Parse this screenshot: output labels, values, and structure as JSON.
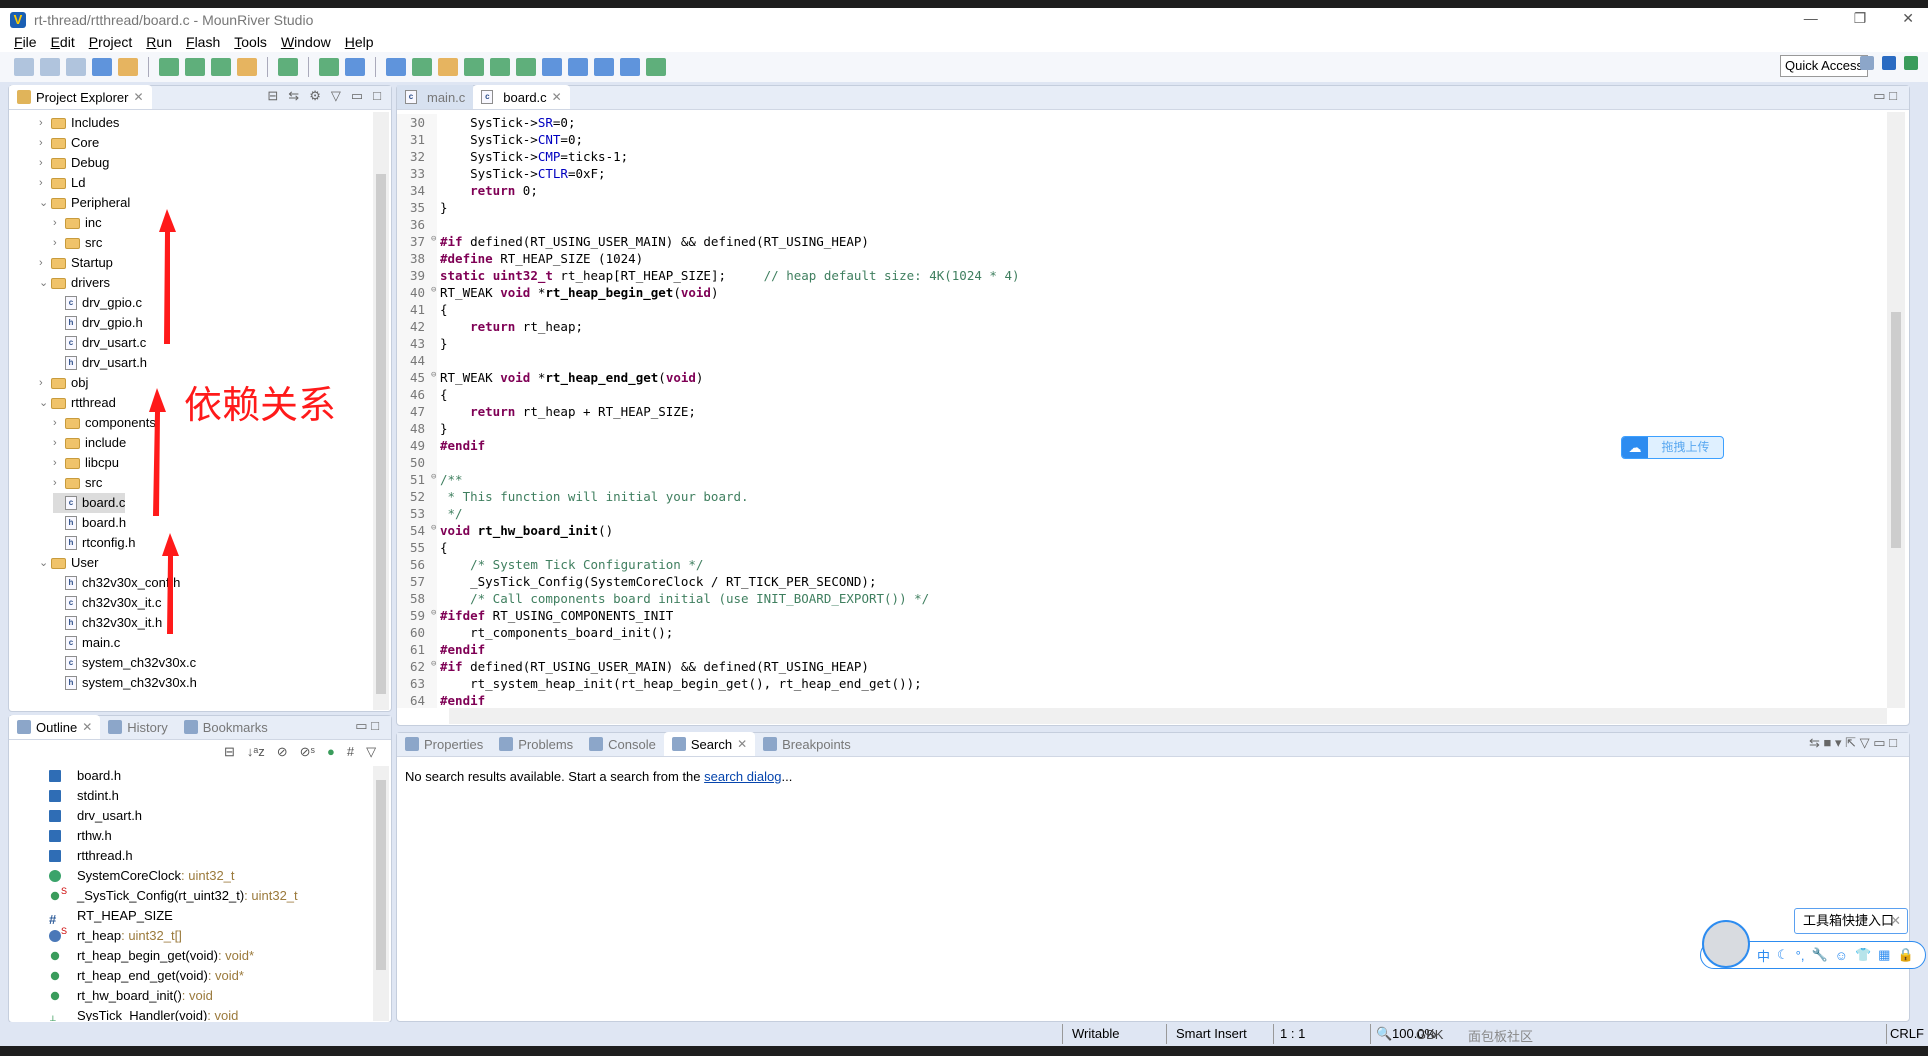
{
  "window": {
    "title": "rt-thread/rtthread/board.c - MounRiver Studio",
    "logo": "V"
  },
  "menu": [
    "File",
    "Edit",
    "Project",
    "Run",
    "Flash",
    "Tools",
    "Window",
    "Help"
  ],
  "toolbar": {
    "quick_access": "Quick Access"
  },
  "explorer": {
    "title": "Project Explorer",
    "items": [
      {
        "label": "Includes",
        "level": 0,
        "kind": "includes",
        "expanded": false
      },
      {
        "label": "Core",
        "level": 0,
        "kind": "folder",
        "expanded": false
      },
      {
        "label": "Debug",
        "level": 0,
        "kind": "folder",
        "expanded": false
      },
      {
        "label": "Ld",
        "level": 0,
        "kind": "folder",
        "expanded": false
      },
      {
        "label": "Peripheral",
        "level": 0,
        "kind": "folder",
        "expanded": true
      },
      {
        "label": "inc",
        "level": 1,
        "kind": "folder",
        "expanded": false
      },
      {
        "label": "src",
        "level": 1,
        "kind": "folder",
        "expanded": false
      },
      {
        "label": "Startup",
        "level": 0,
        "kind": "folder",
        "expanded": false
      },
      {
        "label": "drivers",
        "level": 0,
        "kind": "folder",
        "expanded": true
      },
      {
        "label": "drv_gpio.c",
        "level": 1,
        "kind": "c"
      },
      {
        "label": "drv_gpio.h",
        "level": 1,
        "kind": "h"
      },
      {
        "label": "drv_usart.c",
        "level": 1,
        "kind": "c"
      },
      {
        "label": "drv_usart.h",
        "level": 1,
        "kind": "h"
      },
      {
        "label": "obj",
        "level": 0,
        "kind": "folder",
        "expanded": false
      },
      {
        "label": "rtthread",
        "level": 0,
        "kind": "folder",
        "expanded": true
      },
      {
        "label": "components",
        "level": 1,
        "kind": "folder",
        "expanded": false
      },
      {
        "label": "include",
        "level": 1,
        "kind": "folder",
        "expanded": false
      },
      {
        "label": "libcpu",
        "level": 1,
        "kind": "folder",
        "expanded": false
      },
      {
        "label": "src",
        "level": 1,
        "kind": "folder",
        "expanded": false
      },
      {
        "label": "board.c",
        "level": 1,
        "kind": "c",
        "selected": true
      },
      {
        "label": "board.h",
        "level": 1,
        "kind": "h"
      },
      {
        "label": "rtconfig.h",
        "level": 1,
        "kind": "h"
      },
      {
        "label": "User",
        "level": 0,
        "kind": "folder",
        "expanded": true
      },
      {
        "label": "ch32v30x_conf.h",
        "level": 1,
        "kind": "h"
      },
      {
        "label": "ch32v30x_it.c",
        "level": 1,
        "kind": "c"
      },
      {
        "label": "ch32v30x_it.h",
        "level": 1,
        "kind": "h"
      },
      {
        "label": "main.c",
        "level": 1,
        "kind": "c"
      },
      {
        "label": "system_ch32v30x.c",
        "level": 1,
        "kind": "c"
      },
      {
        "label": "system_ch32v30x.h",
        "level": 1,
        "kind": "h"
      }
    ]
  },
  "annotation": {
    "text": "依赖关系",
    "color": "#ff1a1a"
  },
  "editor": {
    "tabs": [
      {
        "label": "main.c",
        "active": false
      },
      {
        "label": "board.c",
        "active": true
      }
    ],
    "lines": [
      {
        "n": "30",
        "t": [
          [
            "",
            "    SysTick->"
          ],
          [
            "fd",
            "SR"
          ],
          [
            "",
            "=0;"
          ]
        ]
      },
      {
        "n": "31",
        "t": [
          [
            "",
            "    SysTick->"
          ],
          [
            "fd",
            "CNT"
          ],
          [
            "",
            "=0;"
          ]
        ]
      },
      {
        "n": "32",
        "t": [
          [
            "",
            "    SysTick->"
          ],
          [
            "fd",
            "CMP"
          ],
          [
            "",
            "=ticks-1;"
          ]
        ]
      },
      {
        "n": "33",
        "t": [
          [
            "",
            "    SysTick->"
          ],
          [
            "fd",
            "CTLR"
          ],
          [
            "",
            "=0xF;"
          ]
        ]
      },
      {
        "n": "34",
        "t": [
          [
            "",
            "    "
          ],
          [
            "kw",
            "return"
          ],
          [
            "",
            " 0;"
          ]
        ]
      },
      {
        "n": "35",
        "t": [
          [
            "",
            "}"
          ]
        ]
      },
      {
        "n": "36",
        "t": []
      },
      {
        "n": "37",
        "fold": true,
        "t": [
          [
            "kw",
            "#if"
          ],
          [
            "",
            " defined(RT_USING_USER_MAIN) && defined(RT_USING_HEAP)"
          ]
        ]
      },
      {
        "n": "38",
        "t": [
          [
            "kw",
            "#define"
          ],
          [
            "",
            " RT_HEAP_SIZE (1024)"
          ]
        ]
      },
      {
        "n": "39",
        "t": [
          [
            "kw",
            "static"
          ],
          [
            "",
            " "
          ],
          [
            "kw",
            "uint32_t"
          ],
          [
            "",
            " rt_heap[RT_HEAP_SIZE];     "
          ],
          [
            "cm",
            "// heap default size: 4K(1024 * 4)"
          ]
        ]
      },
      {
        "n": "40",
        "fold": true,
        "t": [
          [
            "",
            "RT_WEAK "
          ],
          [
            "kw",
            "void"
          ],
          [
            "",
            " *"
          ],
          [
            "fn",
            "rt_heap_begin_get"
          ],
          [
            "",
            "("
          ],
          [
            "kw",
            "void"
          ],
          [
            "",
            ")"
          ]
        ]
      },
      {
        "n": "41",
        "t": [
          [
            "",
            "{"
          ]
        ]
      },
      {
        "n": "42",
        "t": [
          [
            "",
            "    "
          ],
          [
            "kw",
            "return"
          ],
          [
            "",
            " rt_heap;"
          ]
        ]
      },
      {
        "n": "43",
        "t": [
          [
            "",
            "}"
          ]
        ]
      },
      {
        "n": "44",
        "t": []
      },
      {
        "n": "45",
        "fold": true,
        "t": [
          [
            "",
            "RT_WEAK "
          ],
          [
            "kw",
            "void"
          ],
          [
            "",
            " *"
          ],
          [
            "fn",
            "rt_heap_end_get"
          ],
          [
            "",
            "("
          ],
          [
            "kw",
            "void"
          ],
          [
            "",
            ")"
          ]
        ]
      },
      {
        "n": "46",
        "t": [
          [
            "",
            "{"
          ]
        ]
      },
      {
        "n": "47",
        "t": [
          [
            "",
            "    "
          ],
          [
            "kw",
            "return"
          ],
          [
            "",
            " rt_heap + RT_HEAP_SIZE;"
          ]
        ]
      },
      {
        "n": "48",
        "t": [
          [
            "",
            "}"
          ]
        ]
      },
      {
        "n": "49",
        "t": [
          [
            "kw",
            "#endif"
          ]
        ]
      },
      {
        "n": "50",
        "t": []
      },
      {
        "n": "51",
        "fold": true,
        "t": [
          [
            "cm",
            "/**"
          ]
        ]
      },
      {
        "n": "52",
        "t": [
          [
            "cm",
            " * This function will initial your board."
          ]
        ]
      },
      {
        "n": "53",
        "t": [
          [
            "cm",
            " */"
          ]
        ]
      },
      {
        "n": "54",
        "fold": true,
        "t": [
          [
            "kw",
            "void"
          ],
          [
            "",
            " "
          ],
          [
            "fn",
            "rt_hw_board_init"
          ],
          [
            "",
            "()"
          ]
        ]
      },
      {
        "n": "55",
        "t": [
          [
            "",
            "{"
          ]
        ]
      },
      {
        "n": "56",
        "t": [
          [
            "",
            "    "
          ],
          [
            "cm",
            "/* System Tick Configuration */"
          ]
        ]
      },
      {
        "n": "57",
        "t": [
          [
            "",
            "    _SysTick_Config(SystemCoreClock / RT_TICK_PER_SECOND);"
          ]
        ]
      },
      {
        "n": "58",
        "t": [
          [
            "",
            "    "
          ],
          [
            "cm",
            "/* Call components board initial (use INIT_BOARD_EXPORT()) */"
          ]
        ]
      },
      {
        "n": "59",
        "fold": true,
        "t": [
          [
            "kw",
            "#ifdef"
          ],
          [
            "",
            " RT_USING_COMPONENTS_INIT"
          ]
        ]
      },
      {
        "n": "60",
        "t": [
          [
            "",
            "    rt_components_board_init();"
          ]
        ]
      },
      {
        "n": "61",
        "t": [
          [
            "kw",
            "#endif"
          ]
        ]
      },
      {
        "n": "62",
        "fold": true,
        "t": [
          [
            "kw",
            "#if"
          ],
          [
            "",
            " defined(RT_USING_USER_MAIN) && defined(RT_USING_HEAP)"
          ]
        ]
      },
      {
        "n": "63",
        "t": [
          [
            "",
            "    rt_system_heap_init(rt_heap_begin_get(), rt_heap_end_get());"
          ]
        ]
      },
      {
        "n": "64",
        "t": [
          [
            "kw",
            "#endif"
          ]
        ]
      }
    ]
  },
  "upload_widget": {
    "label": "拖拽上传"
  },
  "outline": {
    "tabs": [
      "Outline",
      "History",
      "Bookmarks"
    ],
    "items": [
      {
        "name": "board.h",
        "type": "",
        "icon": "include"
      },
      {
        "name": "stdint.h",
        "type": "",
        "icon": "include"
      },
      {
        "name": "drv_usart.h",
        "type": "",
        "icon": "include"
      },
      {
        "name": "rthw.h",
        "type": "",
        "icon": "include"
      },
      {
        "name": "rtthread.h",
        "type": "",
        "icon": "include"
      },
      {
        "name": "SystemCoreClock",
        "type": " : uint32_t",
        "icon": "variable"
      },
      {
        "name": "_SysTick_Config(rt_uint32_t)",
        "type": " : uint32_t",
        "icon": "function",
        "static": "S"
      },
      {
        "name": "RT_HEAP_SIZE",
        "type": "",
        "icon": "macro"
      },
      {
        "name": "rt_heap",
        "type": " : uint32_t[]",
        "icon": "static-variable",
        "static": "S"
      },
      {
        "name": "rt_heap_begin_get(void)",
        "type": " : void*",
        "icon": "function"
      },
      {
        "name": "rt_heap_end_get(void)",
        "type": " : void*",
        "icon": "function"
      },
      {
        "name": "rt_hw_board_init()",
        "type": " : void",
        "icon": "function"
      },
      {
        "name": "SysTick_Handler(void)",
        "type": " : void",
        "icon": "handler"
      }
    ]
  },
  "bottom": {
    "tabs": [
      "Properties",
      "Problems",
      "Console",
      "Search",
      "Breakpoints"
    ],
    "active": "Search",
    "message": "No search results available. Start a search from the ",
    "link": "search dialog",
    "ellipsis": "..."
  },
  "ime": {
    "tooltip": "工具箱快捷入口",
    "items": [
      "中",
      "☾",
      "°,",
      "🔧",
      "☺",
      "👕",
      "▦",
      "🔒"
    ]
  },
  "status": {
    "writable": "Writable",
    "insert": "Smart Insert",
    "position": "1 : 1",
    "zoom": "100.0%",
    "encoding": "GBK",
    "line_ending": "CRLF"
  },
  "watermark": "面包板社区"
}
